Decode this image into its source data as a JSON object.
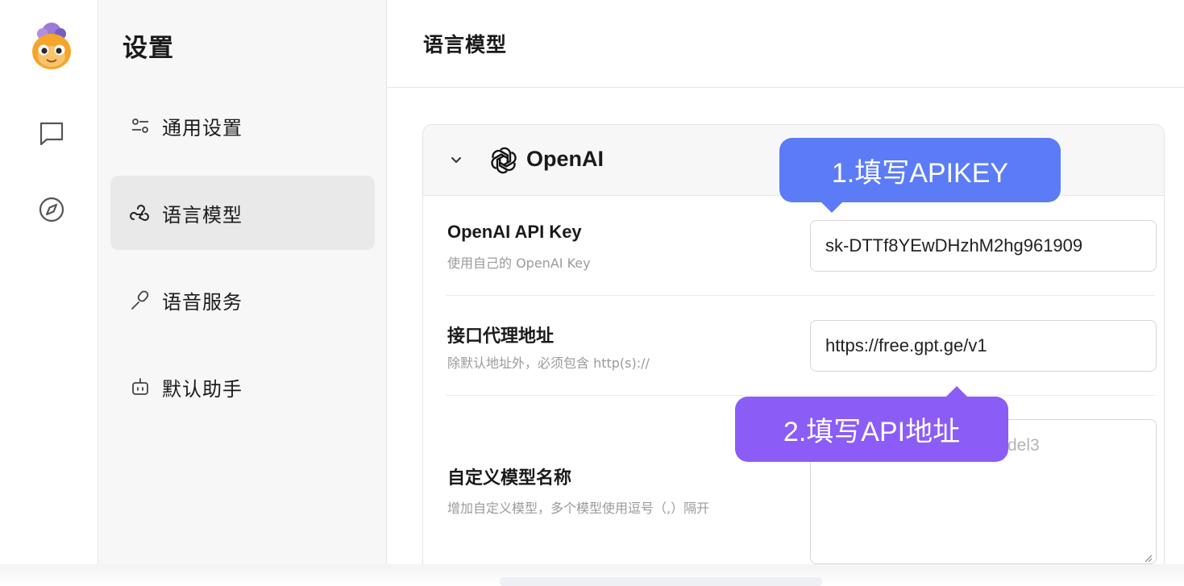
{
  "sidebar": {
    "title": "设置",
    "items": [
      {
        "label": "通用设置",
        "icon": "sliders-icon",
        "active": false
      },
      {
        "label": "语言模型",
        "icon": "webhook-icon",
        "active": true
      },
      {
        "label": "语音服务",
        "icon": "microphone-icon",
        "active": false
      },
      {
        "label": "默认助手",
        "icon": "robot-icon",
        "active": false
      }
    ]
  },
  "rail": {
    "items": [
      {
        "icon": "chat-icon"
      },
      {
        "icon": "compass-icon"
      }
    ]
  },
  "main": {
    "title": "语言模型",
    "provider": {
      "name": "OpenAI",
      "expanded": true,
      "fields": [
        {
          "label": "OpenAI API Key",
          "desc": "使用自己的 OpenAI Key",
          "value": "sk-DTTf8YEwDHzhM2hg961909"
        },
        {
          "label": "接口代理地址",
          "desc": "除默认地址外，必须包含 http(s)://",
          "value": "https://free.gpt.ge/v1"
        },
        {
          "label": "自定义模型名称",
          "desc": "增加自定义模型，多个模型使用逗号（,）隔开",
          "placeholder_visible": "del3"
        }
      ]
    }
  },
  "callouts": {
    "first": "1.填写APIKEY",
    "second": "2.填写API地址"
  },
  "colors": {
    "callout_blue": "#5b7cf6",
    "callout_purple": "#8b5cf6",
    "sidebar_bg": "#f7f7f7",
    "active_item_bg": "#e9e9e9"
  }
}
